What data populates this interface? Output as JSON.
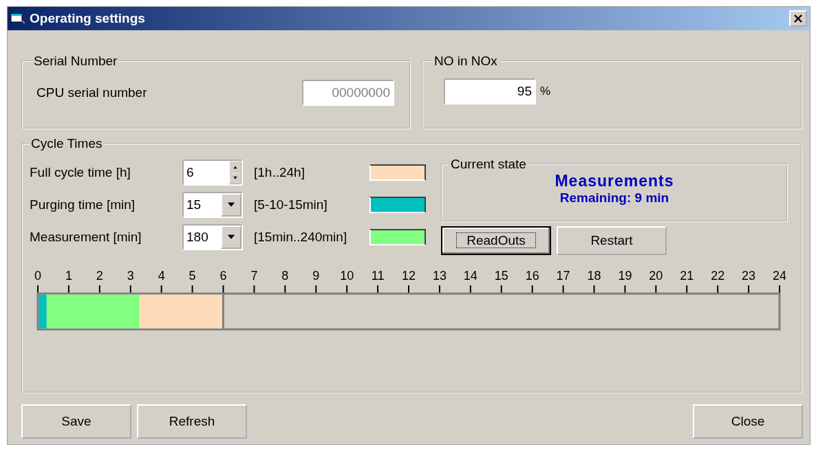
{
  "window": {
    "title": "Operating settings"
  },
  "serial_number": {
    "title": "Serial Number",
    "label": "CPU serial number",
    "value": "00000000",
    "disabled": true
  },
  "no_in_nox": {
    "title": "NO in NOx",
    "value": "95",
    "unit": "%"
  },
  "cycle_times": {
    "title": "Cycle Times",
    "settings": [
      {
        "label": "Full cycle time [h]",
        "kind": "spin",
        "value": "6",
        "range": "[1h..24h]",
        "color": "#ffdcb9"
      },
      {
        "label": "Purging time [min]",
        "kind": "dropdown",
        "value": "15",
        "range": "[5-10-15min]",
        "color": "#00c0c0"
      },
      {
        "label": "Measurement [min]",
        "kind": "dropdown",
        "value": "180",
        "range": "[15min..240min]",
        "color": "#80ff80"
      }
    ],
    "current_state": {
      "title": "Current state",
      "state": "Measurements",
      "remaining": "Remaining: 9 min"
    },
    "buttons": [
      {
        "label": "ReadOuts",
        "focused": true
      },
      {
        "label": "Restart",
        "focused": false
      }
    ],
    "chart_data": {
      "type": "bar",
      "orientation": "horizontal",
      "stacked": true,
      "series": [
        {
          "color": "#00c0c0",
          "values": [
            0.25
          ]
        },
        {
          "color": "#80ff80",
          "values": [
            3
          ]
        },
        {
          "color": "#ffdcb9",
          "values": [
            2.75
          ]
        }
      ],
      "xlim": [
        0,
        24
      ],
      "xticks": [
        0,
        1,
        2,
        3,
        4,
        5,
        6,
        7,
        8,
        9,
        10,
        11,
        12,
        13,
        14,
        15,
        16,
        17,
        18,
        19,
        20,
        21,
        22,
        23,
        24
      ]
    }
  },
  "footer_buttons": [
    "Save",
    "Refresh",
    "Close"
  ]
}
